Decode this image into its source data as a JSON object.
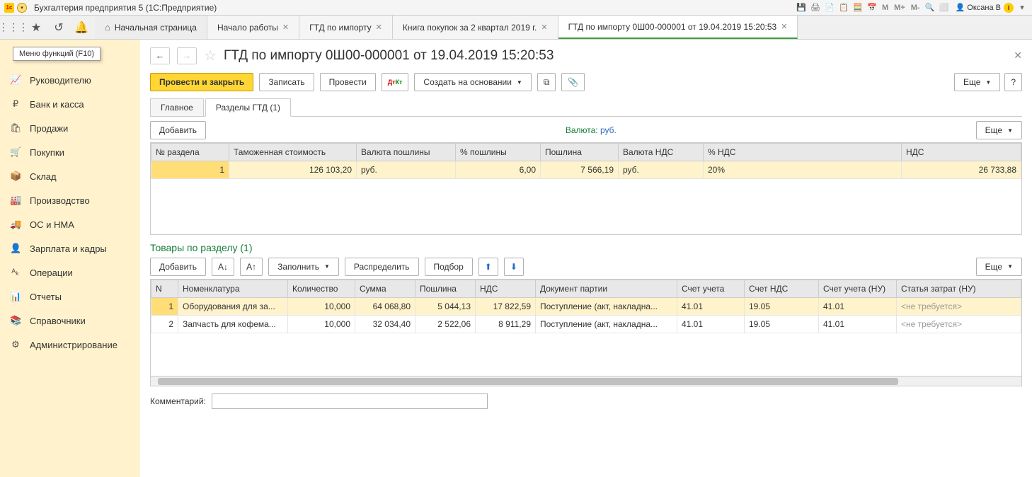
{
  "titlebar": {
    "app_title": "Бухгалтерия предприятия 5   (1С:Предприятие)",
    "user": "Оксана В"
  },
  "tooltip": "Меню функций (F10)",
  "tabs": {
    "home": "Начальная страница",
    "t1": "Начало работы",
    "t2": "ГТД по импорту",
    "t3": "Книга покупок за 2 квартал 2019 г.",
    "t4": "ГТД по импорту 0Ш00-000001 от 19.04.2019 15:20:53"
  },
  "sidebar": {
    "items": [
      {
        "icon": "📈",
        "label": "Руководителю"
      },
      {
        "icon": "₽",
        "label": "Банк и касса"
      },
      {
        "icon": "🛍",
        "label": "Продажи"
      },
      {
        "icon": "🛒",
        "label": "Покупки"
      },
      {
        "icon": "📦",
        "label": "Склад"
      },
      {
        "icon": "🏭",
        "label": "Производство"
      },
      {
        "icon": "🚚",
        "label": "ОС и НМА"
      },
      {
        "icon": "👤",
        "label": "Зарплата и кадры"
      },
      {
        "icon": "ᴬₖ",
        "label": "Операции"
      },
      {
        "icon": "📊",
        "label": "Отчеты"
      },
      {
        "icon": "📚",
        "label": "Справочники"
      },
      {
        "icon": "⚙",
        "label": "Администрирование"
      }
    ]
  },
  "doc": {
    "title": "ГТД по импорту 0Ш00-000001 от 19.04.2019 15:20:53"
  },
  "cmdbar": {
    "post_close": "Провести и закрыть",
    "save": "Записать",
    "post": "Провести",
    "create_based": "Создать на основании",
    "more": "Еще",
    "help": "?"
  },
  "inner_tabs": {
    "main": "Главное",
    "sections": "Разделы ГТД (1)"
  },
  "sections": {
    "add": "Добавить",
    "currency_label": "Валюта:",
    "currency_value": "руб.",
    "headers": {
      "num": "№ раздела",
      "customs_value": "Таможенная стоимость",
      "duty_currency": "Валюта пошлины",
      "duty_pct": "% пошлины",
      "duty": "Пошлина",
      "vat_currency": "Валюта НДС",
      "vat_pct": "% НДС",
      "vat": "НДС"
    },
    "row": {
      "num": "1",
      "customs_value": "126 103,20",
      "duty_currency": "руб.",
      "duty_pct": "6,00",
      "duty": "7 566,19",
      "vat_currency": "руб.",
      "vat_pct": "20%",
      "vat": "26 733,88"
    }
  },
  "goods": {
    "title": "Товары по разделу (1)",
    "add": "Добавить",
    "fill": "Заполнить",
    "distribute": "Распределить",
    "pick": "Подбор",
    "headers": {
      "n": "N",
      "nom": "Номенклатура",
      "qty": "Количество",
      "sum": "Сумма",
      "duty": "Пошлина",
      "vat": "НДС",
      "batch_doc": "Документ партии",
      "acc": "Счет учета",
      "vat_acc": "Счет НДС",
      "acc_nu": "Счет учета (НУ)",
      "cost_item": "Статья затрат (НУ)"
    },
    "rows": [
      {
        "n": "1",
        "nom": "Оборудования для за...",
        "qty": "10,000",
        "sum": "64 068,80",
        "duty": "5 044,13",
        "vat": "17 822,59",
        "batch_doc": "Поступление (акт, накладна...",
        "acc": "41.01",
        "vat_acc": "19.05",
        "acc_nu": "41.01",
        "cost_item": "<не требуется>"
      },
      {
        "n": "2",
        "nom": "Запчасть для кофема...",
        "qty": "10,000",
        "sum": "32 034,40",
        "duty": "2 522,06",
        "vat": "8 911,29",
        "batch_doc": "Поступление (акт, накладна...",
        "acc": "41.01",
        "vat_acc": "19.05",
        "acc_nu": "41.01",
        "cost_item": "<не требуется>"
      }
    ]
  },
  "comment": {
    "label": "Комментарий:"
  }
}
